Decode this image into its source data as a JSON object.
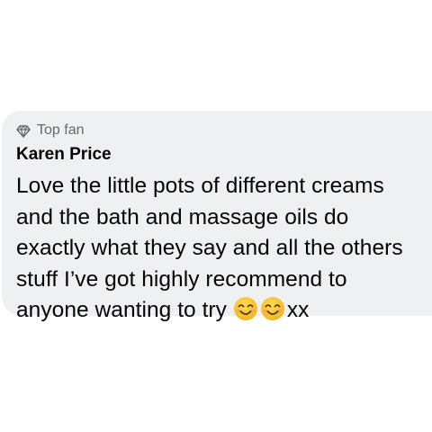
{
  "comment": {
    "badge_label": "Top fan",
    "badge_icon": "diamond-icon",
    "author": "Karen Price",
    "lines": [
      "Love the little pots of different creams",
      "and the bath and massage oils do",
      "exactly what they say and all the others",
      "stuff I’ve got highly recommend to",
      "anyone wanting to try "
    ],
    "emojis": [
      "smiling-face-emoji",
      "smiling-face-emoji"
    ],
    "trailing_text": "xx"
  },
  "colors": {
    "bubble_background": "#eef0f2",
    "badge_text": "#65676b",
    "main_text": "#050505",
    "emoji_face": "#f7c531"
  }
}
